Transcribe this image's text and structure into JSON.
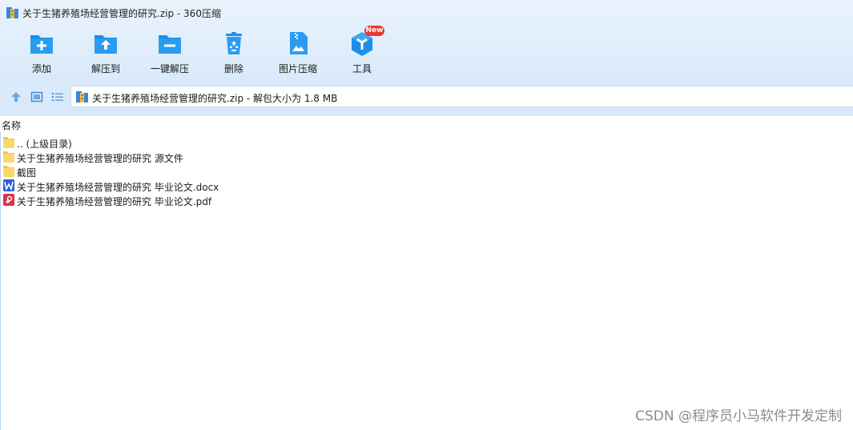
{
  "window": {
    "title": "关于生猪养殖场经营管理的研究.zip",
    "title_separator": " - ",
    "app_name": "360压缩"
  },
  "toolbar": {
    "buttons": [
      {
        "label": "添加",
        "icon": "add-file-icon"
      },
      {
        "label": "解压到",
        "icon": "extract-to-icon"
      },
      {
        "label": "一键解压",
        "icon": "one-click-extract-icon"
      },
      {
        "label": "删除",
        "icon": "recycle-bin-icon"
      },
      {
        "label": "图片压缩",
        "icon": "image-compress-icon"
      },
      {
        "label": "工具",
        "icon": "tools-icon",
        "badge": "New"
      }
    ]
  },
  "nav": {
    "path_text": "关于生猪养殖场经营管理的研究.zip - 解包大小为 1.8 MB"
  },
  "list": {
    "column_name": "名称",
    "items": [
      {
        "name": ".. (上级目录)",
        "type": "folder"
      },
      {
        "name": "关于生猪养殖场经营管理的研究 源文件",
        "type": "folder"
      },
      {
        "name": "截图",
        "type": "folder"
      },
      {
        "name": "关于生猪养殖场经营管理的研究 毕业论文.docx",
        "type": "word"
      },
      {
        "name": "关于生猪养殖场经营管理的研究 毕业论文.pdf",
        "type": "pdf"
      }
    ]
  },
  "watermark": "CSDN @程序员小马软件开发定制",
  "colors": {
    "accent_blue": "#1e90e8",
    "folder_yellow": "#fbd86b",
    "word_blue": "#2b5fd9",
    "pdf_red": "#d9344a",
    "badge_red": "#e53935"
  }
}
